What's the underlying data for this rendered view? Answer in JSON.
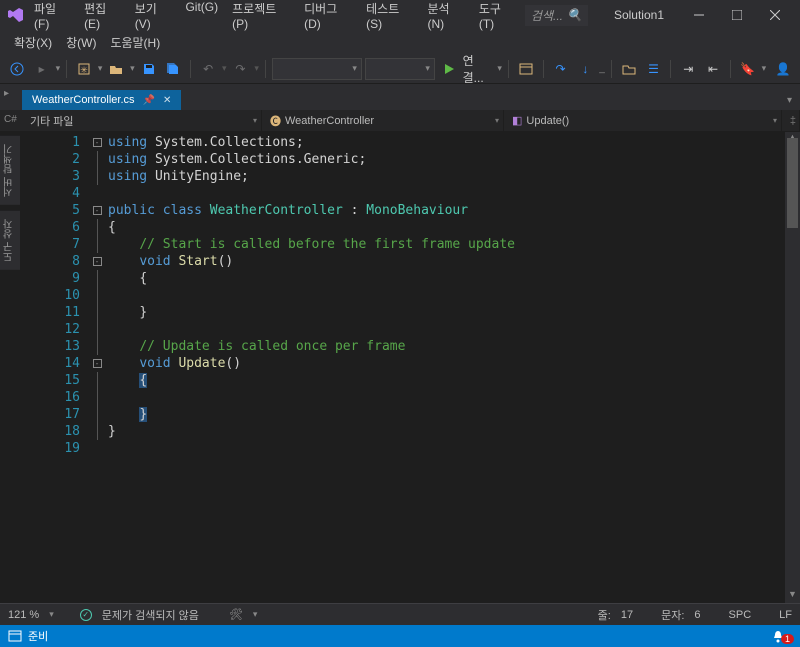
{
  "menu": {
    "row1": [
      "파일(F)",
      "편집(E)",
      "보기(V)",
      "Git(G)",
      "프로젝트(P)",
      "디버그(D)",
      "테스트(S)",
      "분석(N)",
      "도구(T)"
    ],
    "row2": [
      "확장(X)",
      "창(W)",
      "도움말(H)"
    ]
  },
  "search": {
    "placeholder": "검색..."
  },
  "solution": "Solution1",
  "toolbar": {
    "run_label": "연결..."
  },
  "tab": {
    "filename": "WeatherController.cs"
  },
  "sidetabs": [
    "서버 탐색기",
    "도구 상자"
  ],
  "nav": {
    "seg1": "기타 파일",
    "seg2": "WeatherController",
    "seg3": "Update()"
  },
  "code": {
    "lines": [
      {
        "n": 1,
        "fold": "box",
        "tokens": [
          [
            "kw",
            "using"
          ],
          [
            "punct",
            " System.Collections;"
          ]
        ]
      },
      {
        "n": 2,
        "fold": "v",
        "tokens": [
          [
            "kw",
            "using"
          ],
          [
            "punct",
            " System.Collections.Generic;"
          ]
        ]
      },
      {
        "n": 3,
        "fold": "v",
        "tokens": [
          [
            "kw",
            "using"
          ],
          [
            "punct",
            " UnityEngine;"
          ]
        ]
      },
      {
        "n": 4,
        "fold": "",
        "tokens": []
      },
      {
        "n": 5,
        "fold": "box",
        "tokens": [
          [
            "kw",
            "public class"
          ],
          [
            "punct",
            " "
          ],
          [
            "type",
            "WeatherController"
          ],
          [
            "punct",
            " : "
          ],
          [
            "type",
            "MonoBehaviour"
          ]
        ]
      },
      {
        "n": 6,
        "fold": "v",
        "tokens": [
          [
            "punct",
            "{"
          ]
        ]
      },
      {
        "n": 7,
        "fold": "v",
        "indent": 1,
        "tokens": [
          [
            "comment",
            "// Start is called before the first frame update"
          ]
        ]
      },
      {
        "n": 8,
        "fold": "box",
        "indent": 1,
        "tokens": [
          [
            "kw",
            "void"
          ],
          [
            "punct",
            " "
          ],
          [
            "method",
            "Start"
          ],
          [
            "punct",
            "()"
          ]
        ]
      },
      {
        "n": 9,
        "fold": "v",
        "indent": 1,
        "tokens": [
          [
            "punct",
            "{"
          ]
        ]
      },
      {
        "n": 10,
        "fold": "v",
        "indent": 1,
        "tokens": []
      },
      {
        "n": 11,
        "fold": "v",
        "indent": 1,
        "tokens": [
          [
            "punct",
            "}"
          ]
        ]
      },
      {
        "n": 12,
        "fold": "v",
        "indent": 0,
        "tokens": []
      },
      {
        "n": 13,
        "fold": "v",
        "indent": 1,
        "tokens": [
          [
            "comment",
            "// Update is called once per frame"
          ]
        ]
      },
      {
        "n": 14,
        "fold": "box",
        "indent": 1,
        "tokens": [
          [
            "kw",
            "void"
          ],
          [
            "punct",
            " "
          ],
          [
            "method",
            "Update"
          ],
          [
            "punct",
            "()"
          ]
        ]
      },
      {
        "n": 15,
        "fold": "v",
        "indent": 1,
        "tokens": [
          [
            "punct hl-brace",
            "{"
          ]
        ]
      },
      {
        "n": 16,
        "fold": "v",
        "indent": 1,
        "tokens": []
      },
      {
        "n": 17,
        "fold": "v",
        "indent": 1,
        "tokens": [
          [
            "punct hl-brace",
            "}"
          ]
        ]
      },
      {
        "n": 18,
        "fold": "v",
        "tokens": [
          [
            "punct",
            "}"
          ]
        ]
      },
      {
        "n": 19,
        "fold": "",
        "tokens": []
      }
    ]
  },
  "edstatus": {
    "zoom": "121 %",
    "issues": "문제가 검색되지 않음",
    "line_label": "줄:",
    "line_val": "17",
    "col_label": "문자:",
    "col_val": "6",
    "spc": "SPC",
    "lf": "LF"
  },
  "status": {
    "ready": "준비",
    "notif_count": "1"
  }
}
